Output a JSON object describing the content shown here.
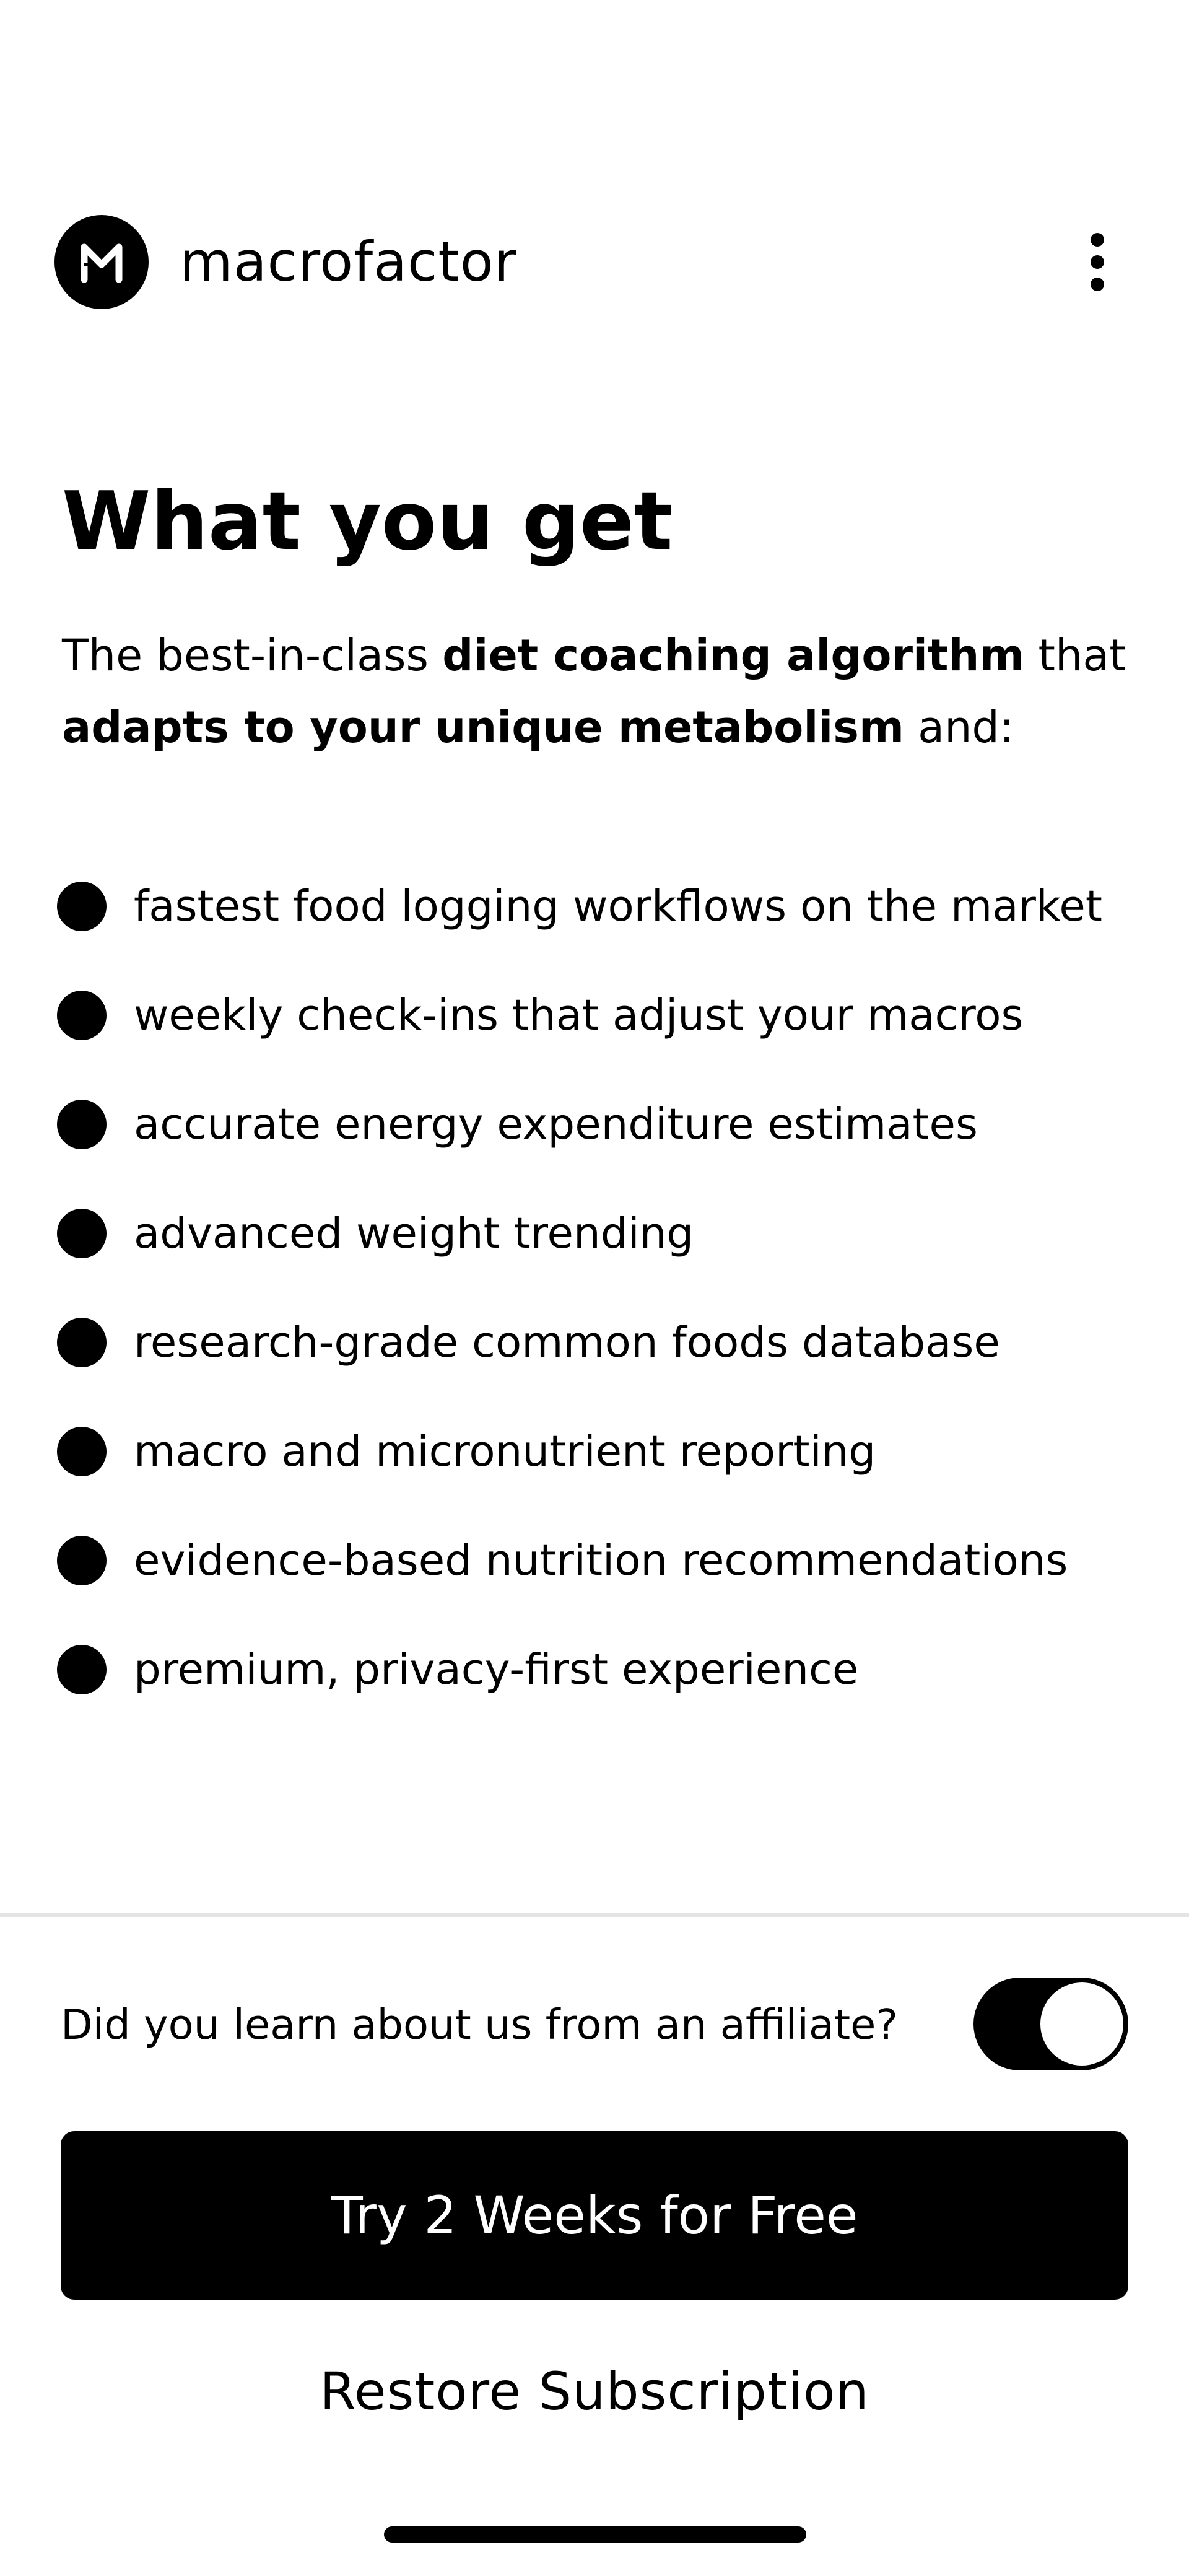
{
  "header": {
    "brand": "macrofactor",
    "logo_icon": "macrofactor-logo-icon",
    "menu_icon": "more-vertical-icon"
  },
  "main": {
    "title": "What you get",
    "intro": {
      "part1": "The best-in-class ",
      "bold1": "diet coaching algorithm",
      "part2": " that ",
      "bold2": "adapts to your unique metabolism",
      "part3": " and:"
    },
    "features": [
      "fastest food logging workflows on the market",
      "weekly check-ins that adjust your macros",
      "accurate energy expenditure estimates",
      "advanced weight trending",
      "research-grade common foods database",
      "macro and micronutrient reporting",
      "evidence-based nutrition recommendations",
      "premium, privacy-first experience"
    ]
  },
  "footer": {
    "affiliate_question": "Did you learn about us from an affiliate?",
    "affiliate_toggle_on": true,
    "cta_label": "Try 2 Weeks for Free",
    "restore_label": "Restore Subscription"
  },
  "colors": {
    "primary": "#000000",
    "background": "#ffffff",
    "divider": "#e4e4e4"
  }
}
